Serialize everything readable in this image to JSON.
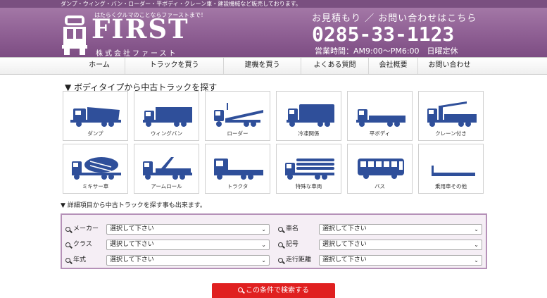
{
  "topbar": {
    "text": "ダンプ・ウィング・バン・ローダー・平ボディ・クレーン車・建設機械など販売しております。"
  },
  "logo": {
    "tagline": "はたらくクルマのことならファーストまで！",
    "name": "FIRST",
    "company": "株式会社ファースト"
  },
  "contact": {
    "lead": "お見積もり ／ お問い合わせはこちら",
    "phone": "0285-33-1123",
    "hours": "営業時間：AM9:00～PM6:00　日曜定休"
  },
  "nav": {
    "items": [
      {
        "label": "ホーム"
      },
      {
        "label": "トラックを買う"
      },
      {
        "label": "建機を買う"
      },
      {
        "label": "よくある質問"
      },
      {
        "label": "会社概要"
      },
      {
        "label": "お問い合わせ"
      }
    ]
  },
  "body_section": {
    "title": "▼ ボディタイプから中古トラックを探す"
  },
  "body_types": [
    {
      "label": "ダンプ",
      "icon": "dump-truck-icon"
    },
    {
      "label": "ウィングバン",
      "icon": "wing-van-icon"
    },
    {
      "label": "ローダー",
      "icon": "loader-truck-icon"
    },
    {
      "label": "冷凍関係",
      "icon": "refrigerated-truck-icon"
    },
    {
      "label": "平ボディ",
      "icon": "flatbed-truck-icon"
    },
    {
      "label": "クレーン付き",
      "icon": "crane-truck-icon"
    },
    {
      "label": "ミキサー車",
      "icon": "mixer-truck-icon"
    },
    {
      "label": "アームロール",
      "icon": "arm-roll-truck-icon"
    },
    {
      "label": "トラクタ",
      "icon": "tractor-head-icon"
    },
    {
      "label": "特殊な車両",
      "icon": "special-vehicle-icon"
    },
    {
      "label": "バス",
      "icon": "bus-icon"
    },
    {
      "label": "乗用車その他",
      "icon": "other-vehicle-icon"
    }
  ],
  "detail_note": "▼ 詳細項目から中古トラックを探す事も出来ます。",
  "search": {
    "fields": [
      {
        "label": "メーカー",
        "value": "選択して下さい"
      },
      {
        "label": "車名",
        "value": "選択して下さい"
      },
      {
        "label": "クラス",
        "value": "選択して下さい"
      },
      {
        "label": "記号",
        "value": "選択して下さい"
      },
      {
        "label": "年式",
        "value": "選択して下さい"
      },
      {
        "label": "走行距離",
        "value": "選択して下さい"
      }
    ],
    "button_label": "この条件で検索する"
  },
  "colors": {
    "brand_purple": "#8e5f93",
    "icon_blue": "#2f4f9a",
    "search_button": "#e02020",
    "panel_border": "#b591b8"
  }
}
